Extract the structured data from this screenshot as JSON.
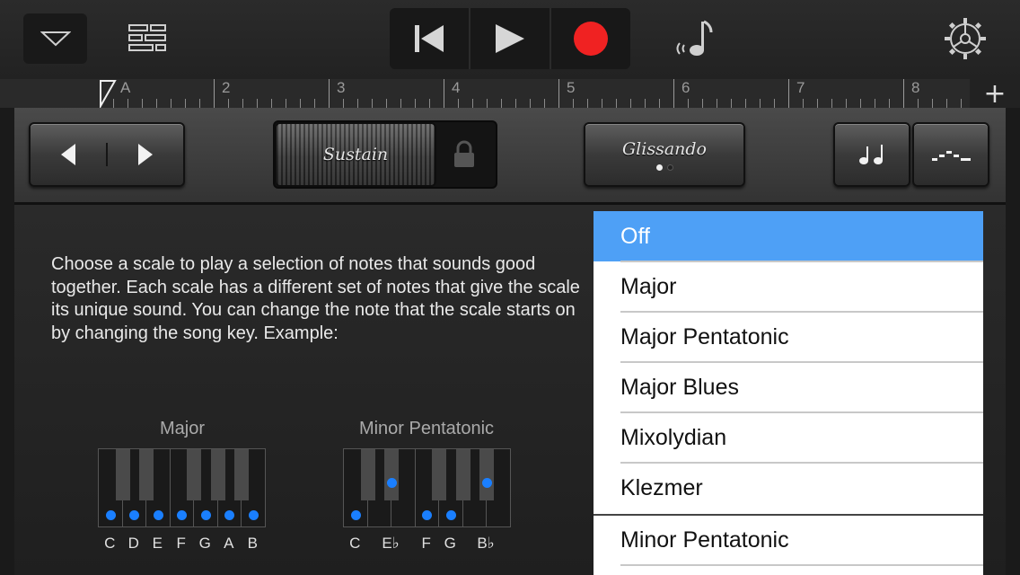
{
  "toolbar": {
    "dropdown_icon": "triangle-down-icon",
    "tracks_icon": "tracks-view-icon",
    "transport": [
      "rewind-icon",
      "play-icon",
      "record-icon"
    ],
    "accent_record": "#f02222",
    "note_icon": "metronome-note-icon",
    "settings_icon": "gear-icon"
  },
  "ruler": {
    "start_marker": "A",
    "bars": [
      "2",
      "3",
      "4",
      "5",
      "6",
      "7",
      "8"
    ],
    "add_label": "+"
  },
  "controls": {
    "sustain_label": "Sustain",
    "glissando_label": "Glissando",
    "glissando_page": 1,
    "glissando_pages": 2
  },
  "help": {
    "description": "Choose a scale to play a selection of notes that sounds good together. Each scale has a different set of notes that give the scale its unique sound. You can change the note that the scale starts on by changing the song key. Example:"
  },
  "examples": {
    "major": {
      "title": "Major",
      "notes": [
        "C",
        "D",
        "E",
        "F",
        "G",
        "A",
        "B"
      ]
    },
    "minor_pentatonic": {
      "title": "Minor Pentatonic",
      "notes": [
        "C",
        "E♭",
        "F",
        "G",
        "B♭"
      ]
    },
    "dot_color": "#1a7fff"
  },
  "scales": {
    "items": [
      "Off",
      "Major",
      "Major Pentatonic",
      "Major Blues",
      "Mixolydian",
      "Klezmer",
      "Minor Pentatonic"
    ],
    "selected": "Off",
    "selected_color": "#4ea0f6"
  }
}
